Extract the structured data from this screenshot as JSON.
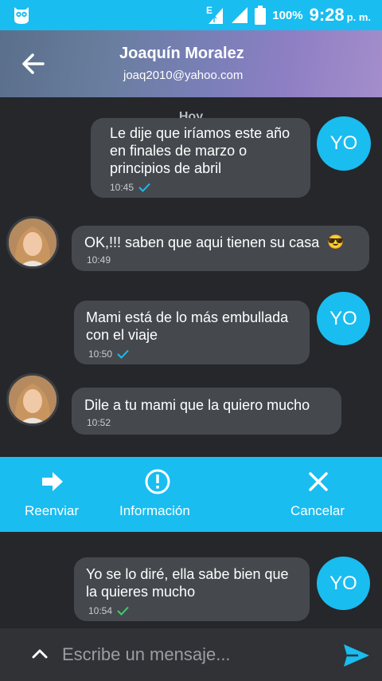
{
  "status_bar": {
    "network": "E",
    "battery": "100%",
    "time": "9:28",
    "ampm": "p. m."
  },
  "header": {
    "name": "Joaquín Moralez",
    "email": "joaq2010@yahoo.com"
  },
  "chat": {
    "date_separator": "Hoy",
    "self_badge": "YO",
    "messages": [
      {
        "from": "me",
        "lines": [
          "Le dije que iríamos este año",
          "en finales de marzo o",
          "principios de abril"
        ],
        "time": "10:45",
        "status": "read"
      },
      {
        "from": "contact",
        "text": "OK,!!! saben que aqui tienen su casa",
        "emoji": "😎",
        "time": "10:49"
      },
      {
        "from": "me",
        "lines": [
          "Mami está de lo más embullada",
          "con el viaje"
        ],
        "time": "10:50",
        "status": "read"
      },
      {
        "from": "contact",
        "text": "Dile a tu mami que la quiero mucho",
        "time": "10:52"
      },
      {
        "from": "me",
        "lines": [
          "Yo se lo diré, ella sabe bien que",
          "la quieres mucho"
        ],
        "time": "10:54",
        "status": "delivered"
      }
    ]
  },
  "actions": {
    "forward": "Reenviar",
    "info": "Información",
    "cancel": "Cancelar"
  },
  "composer": {
    "placeholder": "Escribe un mensaje..."
  },
  "colors": {
    "accent": "#19bdf0",
    "background": "#25272b",
    "bubble": "#45494e",
    "read_check": "#19bdf0",
    "delivered_check": "#3ecf6a"
  }
}
